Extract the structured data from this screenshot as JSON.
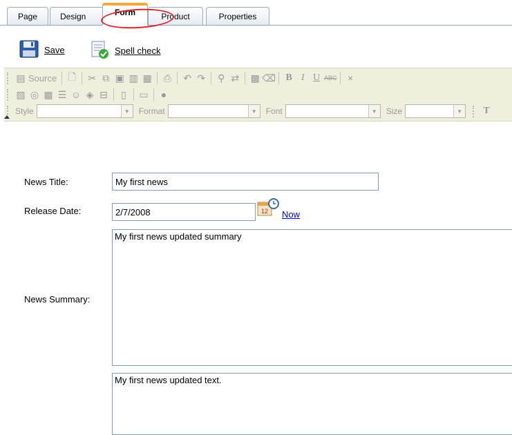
{
  "tabs": [
    {
      "label": "Page"
    },
    {
      "label": "Design"
    },
    {
      "label": "Form"
    },
    {
      "label": "Product"
    },
    {
      "label": "Properties"
    }
  ],
  "active_tab": "Form",
  "actions": {
    "save_label": "Save",
    "spellcheck_label": "Spell check"
  },
  "toolbar": {
    "source_label": "Source",
    "style_label": "Style",
    "format_label": "Format",
    "font_label": "Font",
    "size_label": "Size"
  },
  "form": {
    "title_label": "News Title:",
    "title_value": "My first news",
    "date_label": "Release Date:",
    "date_value": "2/7/2008",
    "now_label": "Now",
    "summary_label": "News Summary:",
    "summary_value": "My first news updated summary",
    "text_value": "My first news updated text."
  },
  "colors": {
    "active_tab_accent": "#f1a83c",
    "highlight_ellipse": "#e0232b",
    "link": "#0000ee",
    "toolbar_bg": "#efefde",
    "input_border": "#7f9db9"
  }
}
